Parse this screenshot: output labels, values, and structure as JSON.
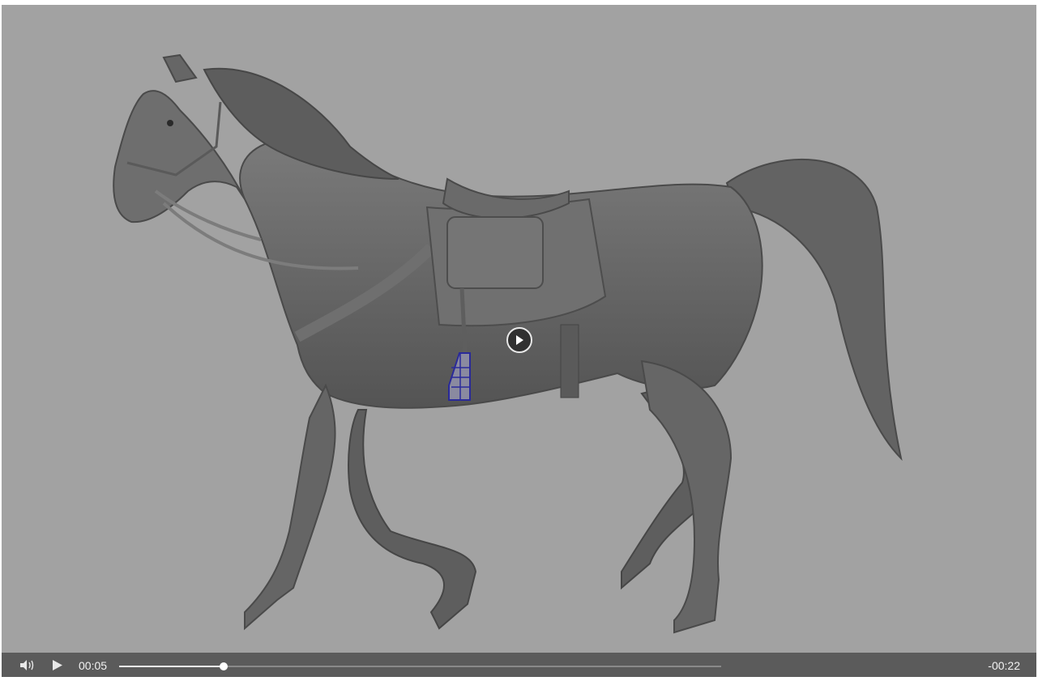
{
  "player": {
    "elapsed": "00:05",
    "remaining": "-00:22",
    "progress_fraction": 0.173,
    "colors": {
      "viewport_bg": "#a2a2a2",
      "control_bar_bg": "#5b5b5b",
      "model": "#6a6a6a",
      "rig_highlight": "#2a2a9a"
    },
    "icons": {
      "volume": "volume-icon",
      "play": "play-icon",
      "center_play": "play-circle-icon"
    }
  }
}
